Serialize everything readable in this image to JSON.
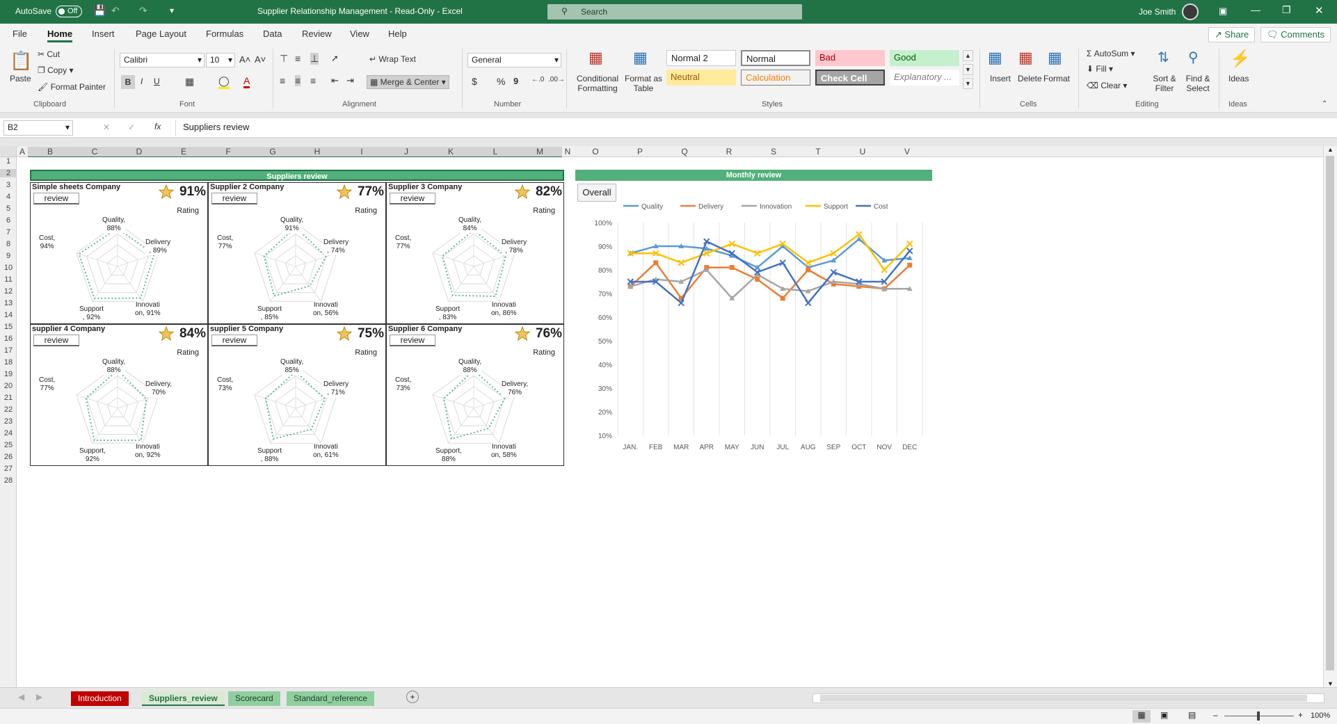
{
  "title_bar": {
    "autosave_label": "AutoSave",
    "autosave_state": "Off",
    "doc_title": "Supplier Relationship Management  -  Read-Only  -  Excel",
    "search_placeholder": "Search",
    "user_name": "Joe Smith"
  },
  "menu": {
    "items": [
      "File",
      "Home",
      "Insert",
      "Page Layout",
      "Formulas",
      "Data",
      "Review",
      "View",
      "Help"
    ],
    "active": "Home",
    "share": "Share",
    "comments": "Comments"
  },
  "ribbon": {
    "clipboard": {
      "paste": "Paste",
      "cut": "Cut",
      "copy": "Copy",
      "format_painter": "Format Painter",
      "group": "Clipboard"
    },
    "font": {
      "name": "Calibri",
      "size": "10",
      "bold": "B",
      "italic": "I",
      "underline": "U",
      "group": "Font"
    },
    "alignment": {
      "wrap": "Wrap Text",
      "merge": "Merge & Center",
      "group": "Alignment"
    },
    "number": {
      "format": "General",
      "currency": "$",
      "percent": "%",
      "comma": "9",
      "group": "Number"
    },
    "styles": {
      "conditional": "Conditional Formatting",
      "format_table": "Format as Table",
      "cells": [
        "Normal 2",
        "Normal",
        "Bad",
        "Good",
        "Neutral",
        "Calculation",
        "Check Cell",
        "Explanatory ..."
      ],
      "group": "Styles"
    },
    "cells": {
      "insert": "Insert",
      "delete": "Delete",
      "format": "Format",
      "group": "Cells"
    },
    "editing": {
      "autosum": "AutoSum",
      "fill": "Fill",
      "clear": "Clear",
      "sort": "Sort & Filter",
      "find": "Find & Select",
      "group": "Editing"
    },
    "ideas": {
      "label": "Ideas",
      "group": "Ideas"
    }
  },
  "formula_bar": {
    "name_box": "B2",
    "fx": "fx",
    "formula": "Suppliers review"
  },
  "columns": [
    "A",
    "B",
    "C",
    "D",
    "E",
    "F",
    "G",
    "H",
    "I",
    "J",
    "K",
    "L",
    "M",
    "N",
    "O",
    "P",
    "Q",
    "R",
    "S",
    "T",
    "U",
    "V"
  ],
  "rows": [
    "1",
    "2",
    "3",
    "4",
    "5",
    "6",
    "7",
    "8",
    "9",
    "10",
    "11",
    "12",
    "13",
    "14",
    "15",
    "16",
    "17",
    "18",
    "19",
    "20",
    "21",
    "22",
    "23",
    "24",
    "25",
    "26",
    "27",
    "28"
  ],
  "suppliers_header": "Suppliers review",
  "monthly_header": "Monthly review",
  "overall_button": "Overall",
  "review_label": "review",
  "rating_label": "Rating",
  "suppliers": [
    {
      "name": "Simple sheets Company",
      "rating": "91%",
      "labels": {
        "quality": [
          "Quality,",
          "88%"
        ],
        "delivery": [
          "Delivery",
          ", 89%"
        ],
        "innovation": [
          "Innovati",
          "on, 91%"
        ],
        "support": [
          "Support",
          ", 92%"
        ],
        "cost": [
          "Cost,",
          "94%"
        ]
      },
      "values": [
        88,
        89,
        91,
        92,
        94
      ]
    },
    {
      "name": "Supplier 2 Company",
      "rating": "77%",
      "labels": {
        "quality": [
          "Quality,",
          "91%"
        ],
        "delivery": [
          "Delivery",
          ", 74%"
        ],
        "innovation": [
          "Innovati",
          "on, 56%"
        ],
        "support": [
          "Support",
          ", 85%"
        ],
        "cost": [
          "Cost,",
          "77%"
        ]
      },
      "values": [
        91,
        74,
        56,
        85,
        77
      ]
    },
    {
      "name": "Supplier 3 Company",
      "rating": "82%",
      "labels": {
        "quality": [
          "Quality,",
          "84%"
        ],
        "delivery": [
          "Delivery",
          ", 78%"
        ],
        "innovation": [
          "Innovati",
          "on, 86%"
        ],
        "support": [
          "Support",
          ", 83%"
        ],
        "cost": [
          "Cost,",
          "77%"
        ]
      },
      "values": [
        84,
        78,
        86,
        83,
        77
      ]
    },
    {
      "name": "supplier 4 Company",
      "rating": "84%",
      "labels": {
        "quality": [
          "Quality,",
          "88%"
        ],
        "delivery": [
          "Delivery,",
          "70%"
        ],
        "innovation": [
          "Innovati",
          "on, 92%"
        ],
        "support": [
          "Support,",
          "92%"
        ],
        "cost": [
          "Cost,",
          "77%"
        ]
      },
      "values": [
        88,
        70,
        92,
        92,
        77
      ]
    },
    {
      "name": "supplier 5 Company",
      "rating": "75%",
      "labels": {
        "quality": [
          "Quality,",
          "85%"
        ],
        "delivery": [
          "Delivery",
          ", 71%"
        ],
        "innovation": [
          "Innovati",
          "on, 61%"
        ],
        "support": [
          "Support",
          ", 88%"
        ],
        "cost": [
          "Cost,",
          "73%"
        ]
      },
      "values": [
        85,
        71,
        61,
        88,
        73
      ]
    },
    {
      "name": "Supplier 6 Company",
      "rating": "76%",
      "labels": {
        "quality": [
          "Quality,",
          "88%"
        ],
        "delivery": [
          "Delivery,",
          "76%"
        ],
        "innovation": [
          "Innovati",
          "on, 58%"
        ],
        "support": [
          "Support,",
          "88%"
        ],
        "cost": [
          "Cost,",
          "73%"
        ]
      },
      "values": [
        88,
        76,
        58,
        88,
        73
      ]
    }
  ],
  "chart_data": {
    "type": "line",
    "categories": [
      "JAN.",
      "FEB",
      "MAR",
      "APR",
      "MAY",
      "JUN",
      "JUL",
      "AUG",
      "SEP",
      "OCT",
      "NOV",
      "DEC"
    ],
    "ylim": [
      10,
      100
    ],
    "yticks": [
      "10%",
      "20%",
      "30%",
      "40%",
      "50%",
      "60%",
      "70%",
      "80%",
      "90%",
      "100%"
    ],
    "legend": "top",
    "series": [
      {
        "name": "Quality",
        "color": "#5b9bd5",
        "values": [
          87,
          90,
          90,
          89,
          86,
          81,
          90,
          81,
          84,
          93,
          84,
          85
        ]
      },
      {
        "name": "Delivery",
        "color": "#ed7d31",
        "values": [
          73,
          83,
          68,
          81,
          81,
          76,
          68,
          80,
          74,
          73,
          72,
          82
        ]
      },
      {
        "name": "Innovation",
        "color": "#a5a5a5",
        "values": [
          73,
          76,
          75,
          80,
          68,
          78,
          72,
          71,
          75,
          74,
          72,
          72
        ]
      },
      {
        "name": "Support",
        "color": "#ffc000",
        "values": [
          87,
          87,
          83,
          87,
          91,
          87,
          91,
          83,
          87,
          95,
          80,
          91
        ]
      },
      {
        "name": "Cost",
        "color": "#4472c4",
        "values": [
          75,
          75,
          66,
          92,
          87,
          79,
          83,
          66,
          79,
          75,
          75,
          88
        ]
      }
    ]
  },
  "sheet_tabs": [
    {
      "label": "Introduction",
      "bg": "#c00000",
      "color": "#ffffff"
    },
    {
      "label": "Suppliers_review",
      "bg": "#d9ead3",
      "color": "#217346"
    },
    {
      "label": "Scorecard",
      "bg": "#8fcf9f",
      "color": "#1d3c28"
    },
    {
      "label": "Standard_reference",
      "bg": "#8fcf9f",
      "color": "#1d3c28"
    }
  ],
  "status": {
    "zoom": "100%"
  }
}
